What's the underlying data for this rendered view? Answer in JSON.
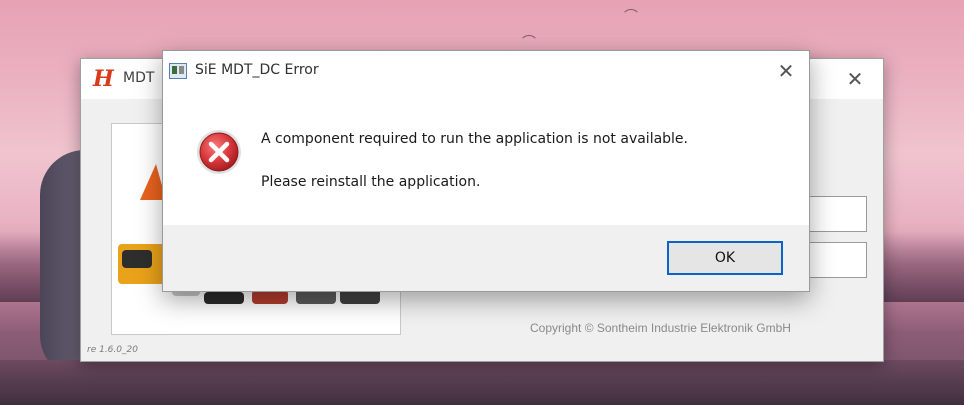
{
  "main_window": {
    "title": "MDT",
    "logo_text": "H",
    "copyright": "Copyright © Sontheim Industrie Elektronik GmbH",
    "version": "re 1.6.0_20"
  },
  "dialog": {
    "title": "SiE MDT_DC Error",
    "message_line1": "A component required to run the application is not available.",
    "message_line2": "Please reinstall the application.",
    "ok_label": "OK",
    "close_glyph": "✕"
  },
  "colors": {
    "accent": "#0a64c8",
    "error_red": "#d9383b",
    "logo_red": "#d83a1c",
    "brand_orange": "#e8631e"
  },
  "icons": {
    "dialog_icon": "error-icon",
    "title_icon": "app-window-icon"
  }
}
